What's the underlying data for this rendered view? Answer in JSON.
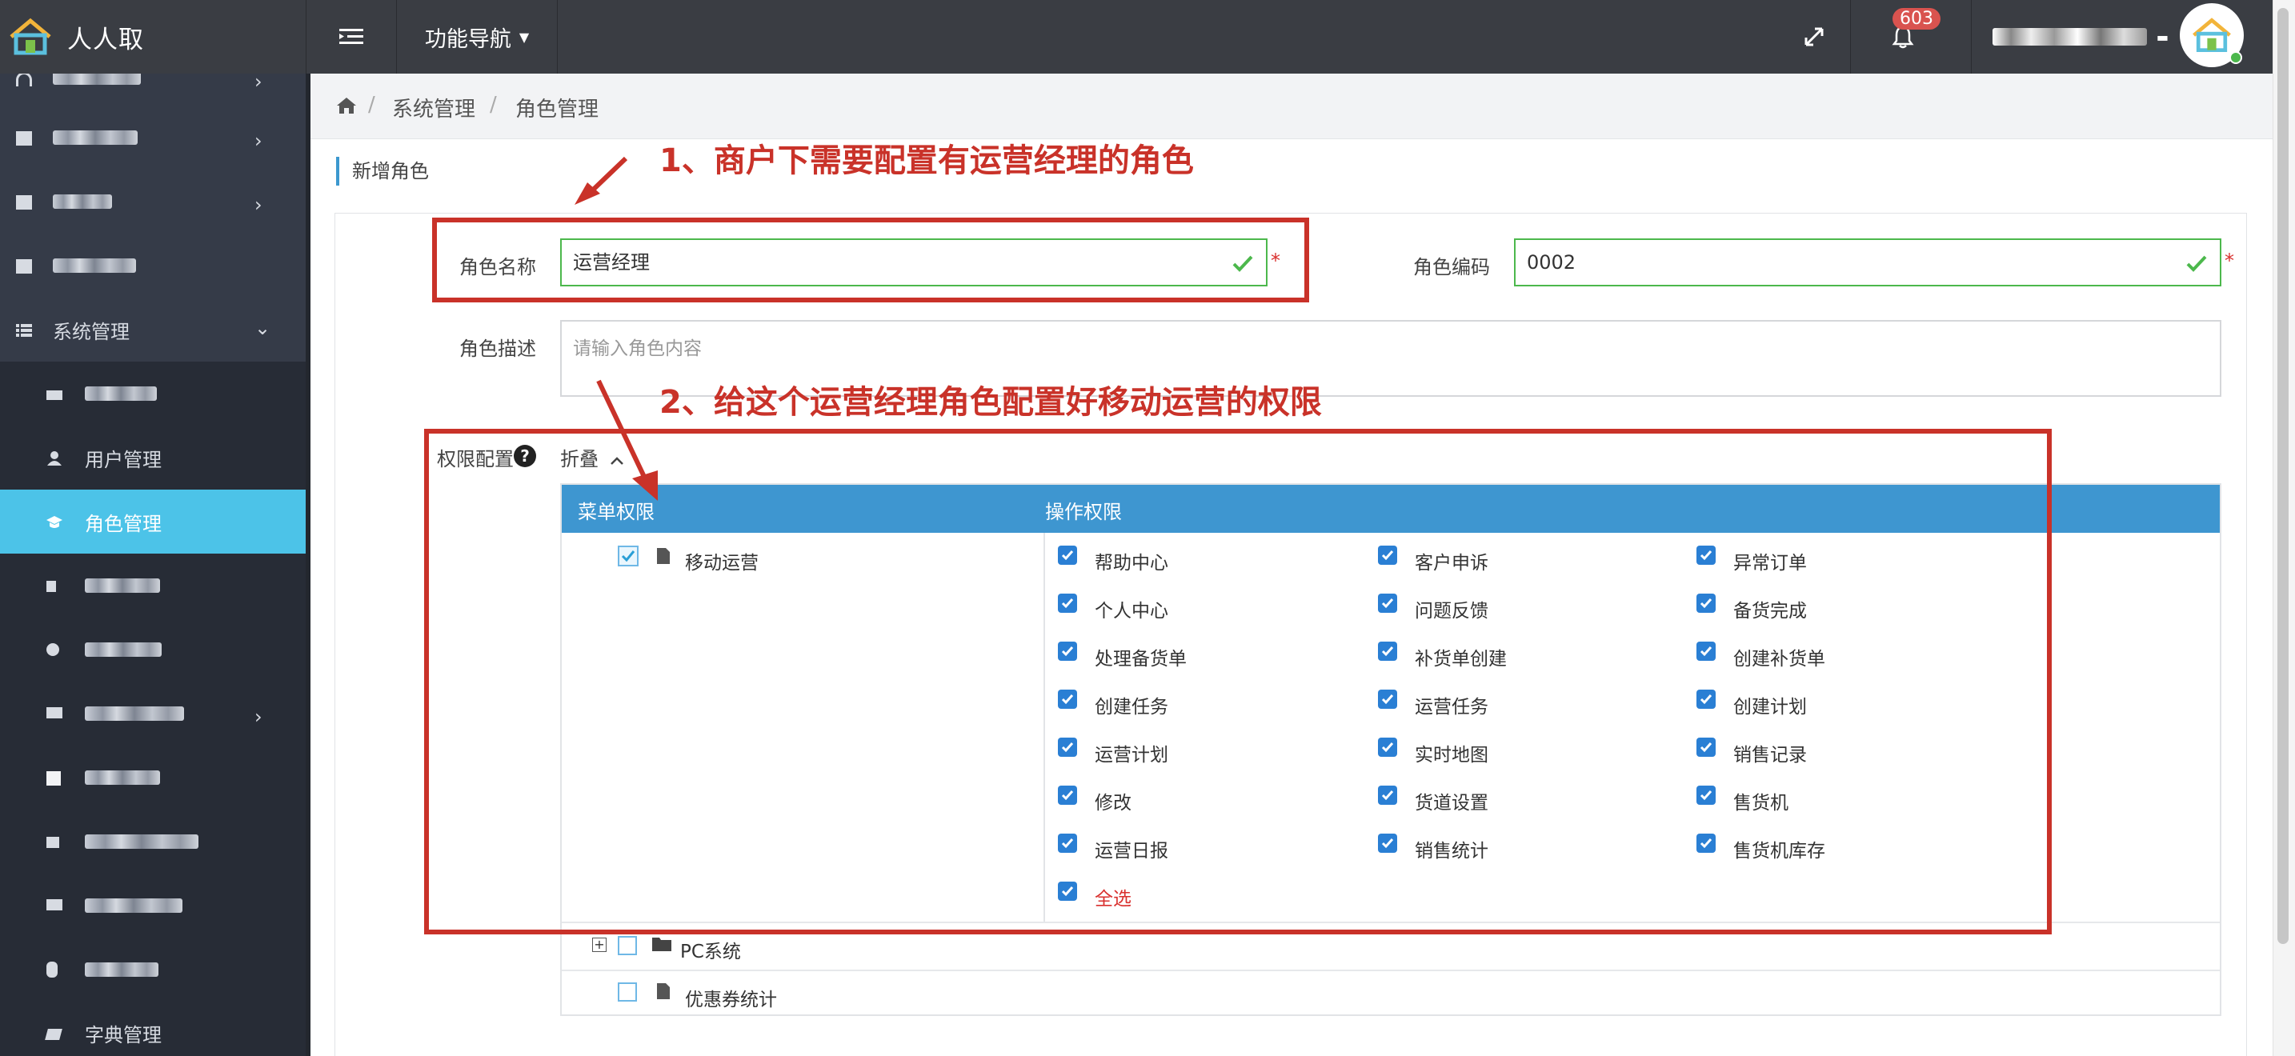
{
  "app": {
    "title": "人人取",
    "nav_menu_label": "功能导航",
    "notification_count": "603"
  },
  "colors": {
    "accent": "#4cc3e8",
    "header_bg": "#3a3d43",
    "sidebar_bg": "#2f3541",
    "annotation": "#c93229",
    "valid": "#4cb84c",
    "tree_header": "#3e96d0"
  },
  "icons": {
    "logo": "house-logo-icon",
    "menu": "menu-toggle-icon",
    "fullscreen": "fullscreen-icon",
    "bell": "bell-icon",
    "home": "home-icon"
  },
  "sidebar": {
    "system_management": "系统管理",
    "user_management": "用户管理",
    "role_management": "角色管理",
    "dictionary_management": "字典管理"
  },
  "breadcrumb": {
    "item1": "系统管理",
    "item2": "角色管理",
    "sep": "/"
  },
  "page": {
    "section_title": "新增角色"
  },
  "form": {
    "role_name_label": "角色名称",
    "role_name_value": "运营经理",
    "role_code_label": "角色编码",
    "role_code_value": "0002",
    "role_desc_label": "角色描述",
    "role_desc_placeholder": "请输入角色内容",
    "permission_label": "权限配置",
    "collapse_label": "折叠",
    "required_mark": "*"
  },
  "tree": {
    "menu_header": "菜单权限",
    "op_header": "操作权限",
    "node_mobile_ops": "移动运营",
    "node_pc_system": "PC系统",
    "node_coupon_stats": "优惠券统计",
    "permissions": [
      {
        "label": "帮助中心",
        "checked": true
      },
      {
        "label": "客户申诉",
        "checked": true
      },
      {
        "label": "异常订单",
        "checked": true
      },
      {
        "label": "个人中心",
        "checked": true
      },
      {
        "label": "问题反馈",
        "checked": true
      },
      {
        "label": "备货完成",
        "checked": true
      },
      {
        "label": "处理备货单",
        "checked": true
      },
      {
        "label": "补货单创建",
        "checked": true
      },
      {
        "label": "创建补货单",
        "checked": true
      },
      {
        "label": "创建任务",
        "checked": true
      },
      {
        "label": "运营任务",
        "checked": true
      },
      {
        "label": "创建计划",
        "checked": true
      },
      {
        "label": "运营计划",
        "checked": true
      },
      {
        "label": "实时地图",
        "checked": true
      },
      {
        "label": "销售记录",
        "checked": true
      },
      {
        "label": "修改",
        "checked": true
      },
      {
        "label": "货道设置",
        "checked": true
      },
      {
        "label": "售货机",
        "checked": true
      },
      {
        "label": "运营日报",
        "checked": true
      },
      {
        "label": "销售统计",
        "checked": true
      },
      {
        "label": "售货机库存",
        "checked": true
      }
    ],
    "select_all": "全选"
  },
  "annotations": {
    "note1": "1、商户下需要配置有运营经理的角色",
    "note2": "2、给这个运营经理角色配置好移动运营的权限"
  }
}
